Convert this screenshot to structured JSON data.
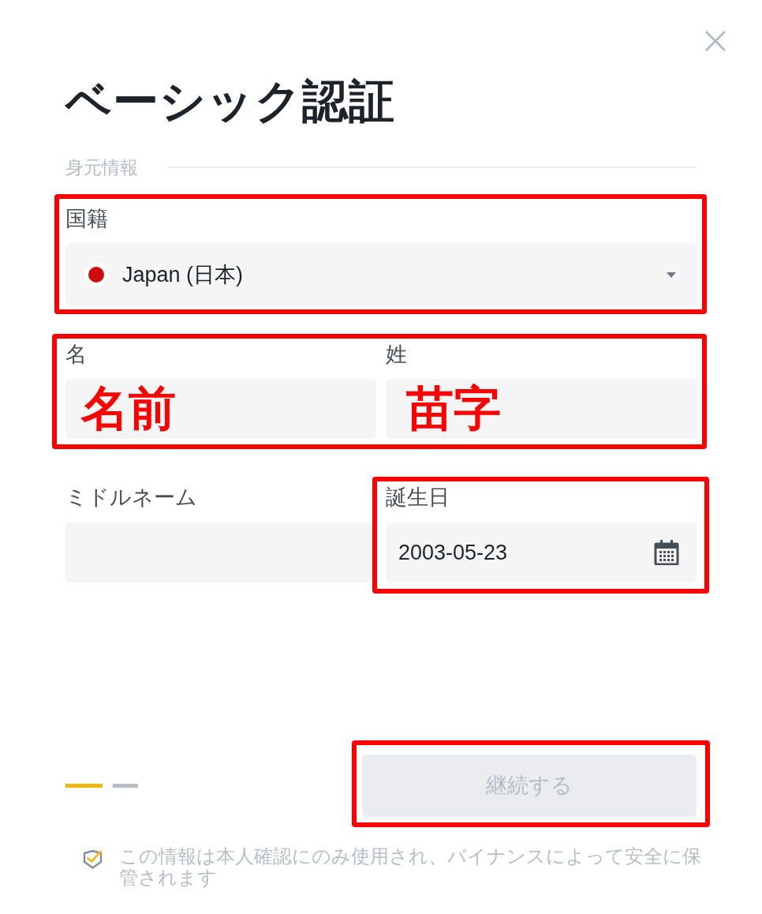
{
  "dialog": {
    "title": "ベーシック認証"
  },
  "section": {
    "label": "身元情報"
  },
  "nationality": {
    "label": "国籍",
    "value": "Japan (日本)",
    "highlighted": true
  },
  "name_group": {
    "highlighted": true,
    "first_name": {
      "label": "名",
      "value": "名前"
    },
    "last_name": {
      "label": "姓",
      "value": "苗字"
    }
  },
  "middle_name": {
    "label": "ミドルネーム"
  },
  "birthday": {
    "label": "誕生日",
    "value": "2003-05-23",
    "highlighted": true
  },
  "steps": [
    {
      "selected": true
    },
    {
      "selected": false
    }
  ],
  "continue_button": {
    "label": "継続する",
    "disabled": true,
    "highlighted": true
  },
  "notice": {
    "text": "この情報は本人確認にのみ使用され、バイナンスによって安全に保管されます"
  }
}
